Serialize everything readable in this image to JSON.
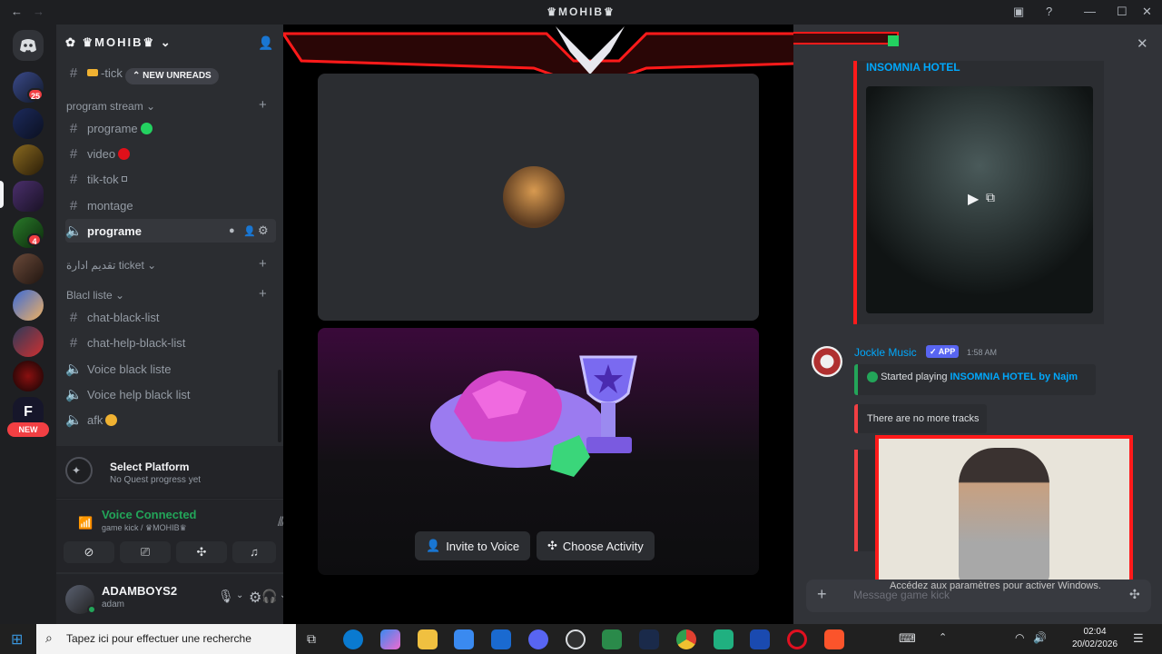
{
  "window": {
    "title": "♛MOHIB♛"
  },
  "server": {
    "name": "♛MOHIB♛",
    "rail_badges": [
      "25",
      "4"
    ],
    "new_label": "NEW"
  },
  "sidebar": {
    "partial_channel": "-tick",
    "new_unreads": "NEW UNREADS",
    "categories": [
      {
        "name": "program stream",
        "channels": [
          "programe",
          "video",
          "tik-tok",
          "montage",
          "programe"
        ]
      },
      {
        "name": "تقديم ادارة ticket"
      },
      {
        "name": "Blacl liste",
        "channels": [
          "chat-black-list",
          "chat-help-black-list",
          "Voice black liste",
          "Voice help black list",
          "afk"
        ]
      }
    ]
  },
  "quest": {
    "title": "Select Platform",
    "subtitle": "No Quest progress yet"
  },
  "voice": {
    "status": "Voice Connected",
    "location": "game kick",
    "server": "♛MOHIB♛"
  },
  "user": {
    "name": "ADAMBOYS2",
    "status": "adam"
  },
  "stage": {
    "invite_label": "Invite to Voice",
    "activity_label": "Choose Activity"
  },
  "chat": {
    "track_title": "INSOMNIA HOTEL",
    "bot_name": "Jockle Music",
    "bot_tag": "APP",
    "timestamp": "1:58 AM",
    "now_playing_prefix": "Started playing ",
    "now_playing_track": "INSOMNIA HOTEL by Najm",
    "no_more_tracks": "There are no more tracks",
    "message_placeholder": "Message game kick",
    "activate_windows": "Accédez aux paramètres pour activer Windows."
  },
  "taskbar": {
    "search_placeholder": "Tapez ici pour effectuer une recherche",
    "time": "02:04",
    "date": "20/02/2026"
  },
  "colors": {
    "accent": "#5865f2",
    "online": "#23a559",
    "danger": "#f23f43",
    "link": "#00a8fc",
    "red_frame": "#ff1a1a"
  }
}
